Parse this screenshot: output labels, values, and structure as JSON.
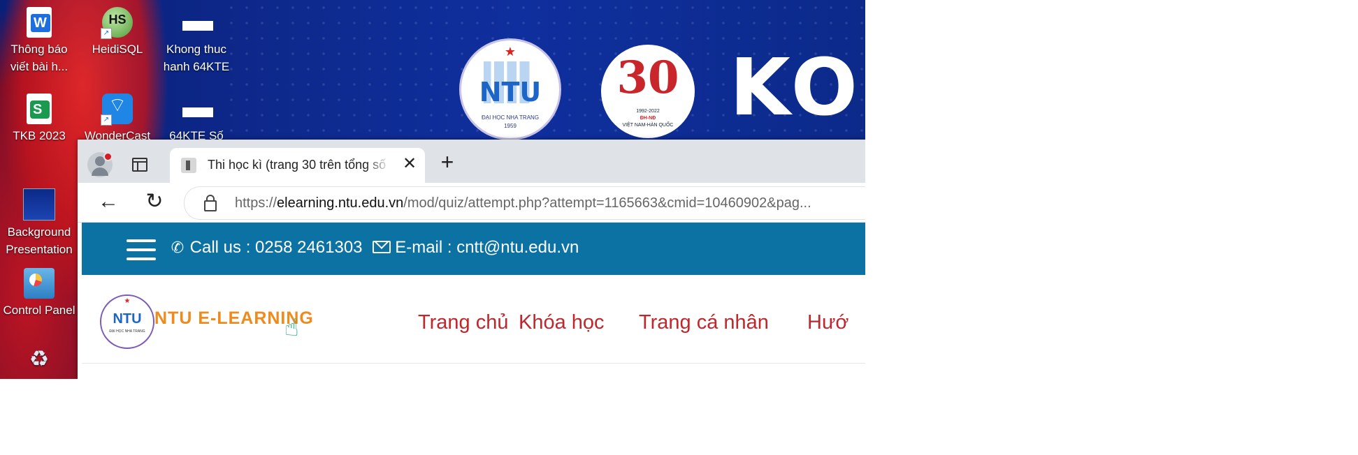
{
  "desktop": {
    "icons": [
      {
        "label": "Thông báo viết bài h...",
        "icon": "word-doc-icon"
      },
      {
        "label": "HeidiSQL",
        "icon": "heidisql-icon"
      },
      {
        "label": "Khong thuc hanh 64KTE",
        "icon": "file-icon"
      },
      {
        "label": "TKB 2023",
        "icon": "spreadsheet-icon"
      },
      {
        "label": "WonderCast",
        "icon": "wondercast-icon"
      },
      {
        "label": "64KTE Số",
        "icon": "file-icon"
      },
      {
        "label": "Background Presentation",
        "icon": "presentation-icon"
      },
      {
        "label": "Control Panel",
        "icon": "control-panel-icon"
      },
      {
        "label": "",
        "icon": "recycle-bin-icon"
      }
    ],
    "wallpaper": {
      "logo_text": "NTU",
      "logo_subtitle": "ĐẠI HỌC NHA TRANG",
      "logo_year": "1959",
      "anniversary_years": "1992-2022",
      "anniversary_title": "ĐH-NĐ",
      "anniversary_subtitle": "VIỆT NAM-HÀN QUỐC",
      "banner_text": "KOIC"
    }
  },
  "browser": {
    "tab": {
      "title": "Thi học kì (trang 30 trên tổng số"
    },
    "url": {
      "scheme": "https://",
      "domain": "elearning.ntu.edu.vn",
      "path": "/mod/quiz/attempt.php?attempt=1165663&cmid=10460902&pag..."
    }
  },
  "page": {
    "call_label": "Call us : 0258 2461303",
    "email_label": "E-mail : cntt@ntu.edu.vn",
    "logo_text": "NTU",
    "logo_sub": "ĐẠI HỌC NHA TRANG",
    "site_name": "NTU E-LEARNING",
    "nav": [
      "Trang chủ",
      "Khóa học",
      "Trang cá nhân",
      "Hướ"
    ]
  },
  "colors": {
    "topbar": "#0b72a3",
    "nav_text": "#c0272d",
    "site_name": "#f08a1d"
  }
}
